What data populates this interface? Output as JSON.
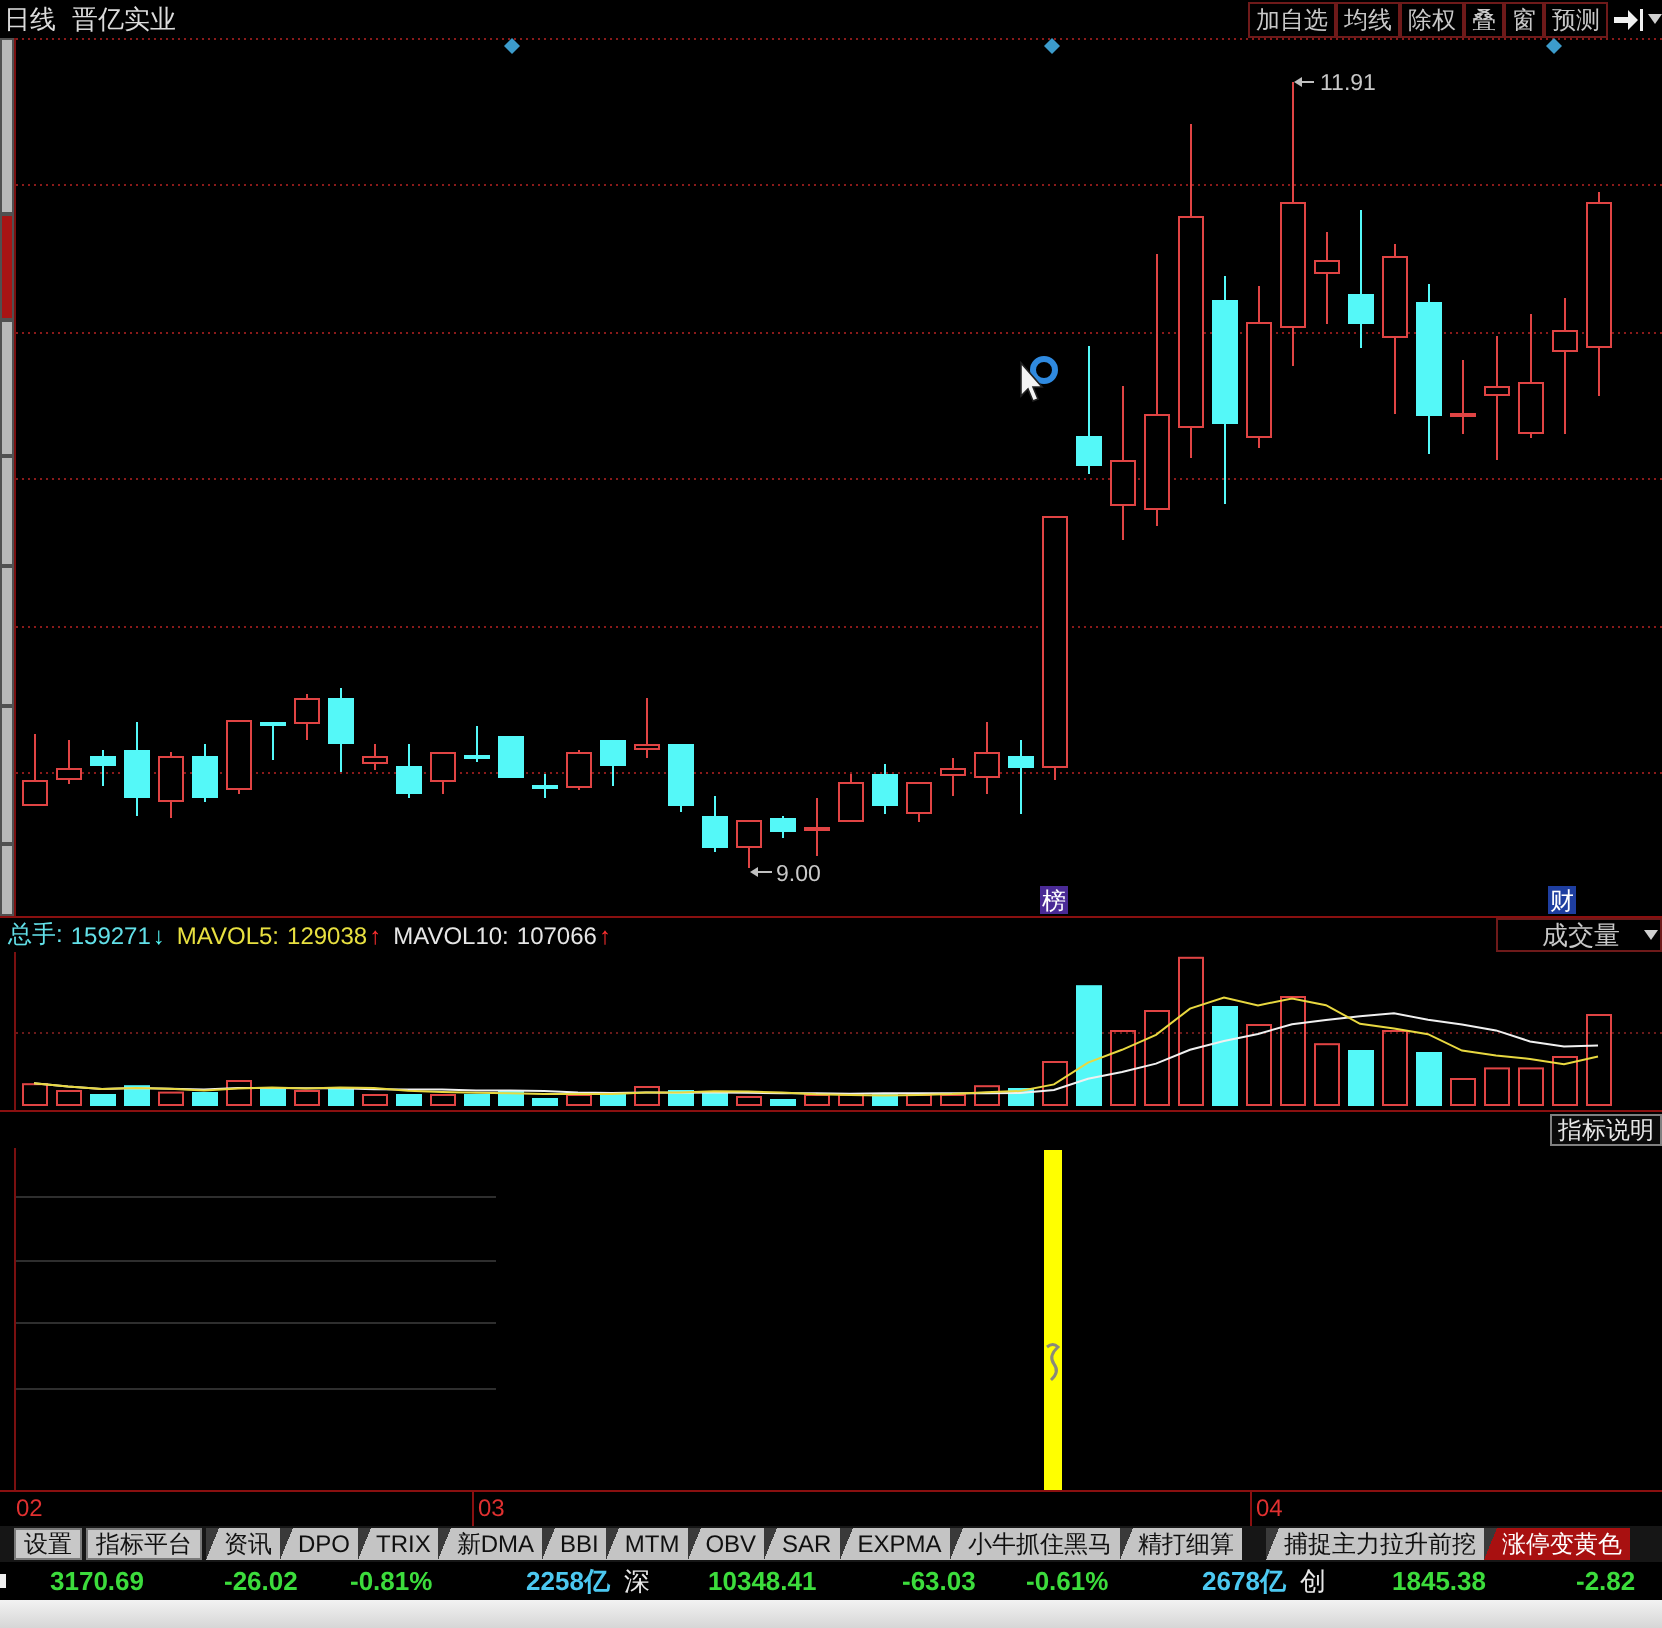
{
  "header": {
    "period": "日线",
    "stock_name": "晋亿实业",
    "buttons": [
      "加自选",
      "均线",
      "除权",
      "叠",
      "窗",
      "预测"
    ]
  },
  "side_tabs": [
    {
      "selected": false
    },
    {
      "selected": true
    },
    {
      "selected": false
    },
    {
      "selected": false
    },
    {
      "selected": false
    },
    {
      "selected": false
    },
    {
      "selected": false
    }
  ],
  "price_chart": {
    "high_label": "11.91",
    "low_label": "9.00",
    "event_badges": [
      {
        "text": "榜",
        "color": "#4a2a96"
      },
      {
        "text": "财",
        "color": "#1e3ea0"
      }
    ]
  },
  "volume_panel": {
    "readings": [
      {
        "label": "总手:",
        "value": "159271",
        "arrow": "↓",
        "rising": false,
        "color": "#62e0e8"
      },
      {
        "label": "MAVOL5:",
        "value": "129038",
        "arrow": "↑",
        "rising": true,
        "color": "#e8e040"
      },
      {
        "label": "MAVOL10:",
        "value": "107066",
        "arrow": "↑",
        "rising": true,
        "color": "#e6e6e6"
      }
    ],
    "indicator": "成交量"
  },
  "signal_panel": {
    "button": "指标说明"
  },
  "x_axis": {
    "labels": [
      "02",
      "03",
      "04"
    ]
  },
  "bottom_tabs": [
    {
      "label": "设置",
      "kind": "button",
      "selected": false
    },
    {
      "label": "指标平台",
      "kind": "button",
      "selected": false
    },
    {
      "label": "资讯",
      "kind": "tab",
      "selected": false
    },
    {
      "label": "DPO",
      "kind": "tab",
      "selected": false
    },
    {
      "label": "TRIX",
      "kind": "tab",
      "selected": false
    },
    {
      "label": "新DMA",
      "kind": "tab",
      "selected": false
    },
    {
      "label": "BBI",
      "kind": "tab",
      "selected": false
    },
    {
      "label": "MTM",
      "kind": "tab",
      "selected": false
    },
    {
      "label": "OBV",
      "kind": "tab",
      "selected": false
    },
    {
      "label": "SAR",
      "kind": "tab",
      "selected": false
    },
    {
      "label": "EXPMA",
      "kind": "tab",
      "selected": false
    },
    {
      "label": "小牛抓住黑马",
      "kind": "tab",
      "selected": false
    },
    {
      "label": "精打细算",
      "kind": "tab",
      "selected": false
    },
    {
      "label": "捕捉主力拉升前挖",
      "kind": "tab",
      "selected": false
    },
    {
      "label": "涨停变黄色",
      "kind": "tab",
      "selected": true
    }
  ],
  "status_bar": [
    {
      "text": "3170.69",
      "kind": "index"
    },
    {
      "text": "-26.02",
      "kind": "change"
    },
    {
      "text": "-0.81%",
      "kind": "change"
    },
    {
      "text": "2258亿",
      "kind": "turnover"
    },
    {
      "text": "深",
      "kind": "market"
    },
    {
      "text": "10348.41",
      "kind": "index"
    },
    {
      "text": "-63.03",
      "kind": "change"
    },
    {
      "text": "-0.61%",
      "kind": "change"
    },
    {
      "text": "2678亿",
      "kind": "turnover"
    },
    {
      "text": "创",
      "kind": "market"
    },
    {
      "text": "1845.38",
      "kind": "index"
    },
    {
      "text": "-2.82",
      "kind": "change"
    }
  ]
}
